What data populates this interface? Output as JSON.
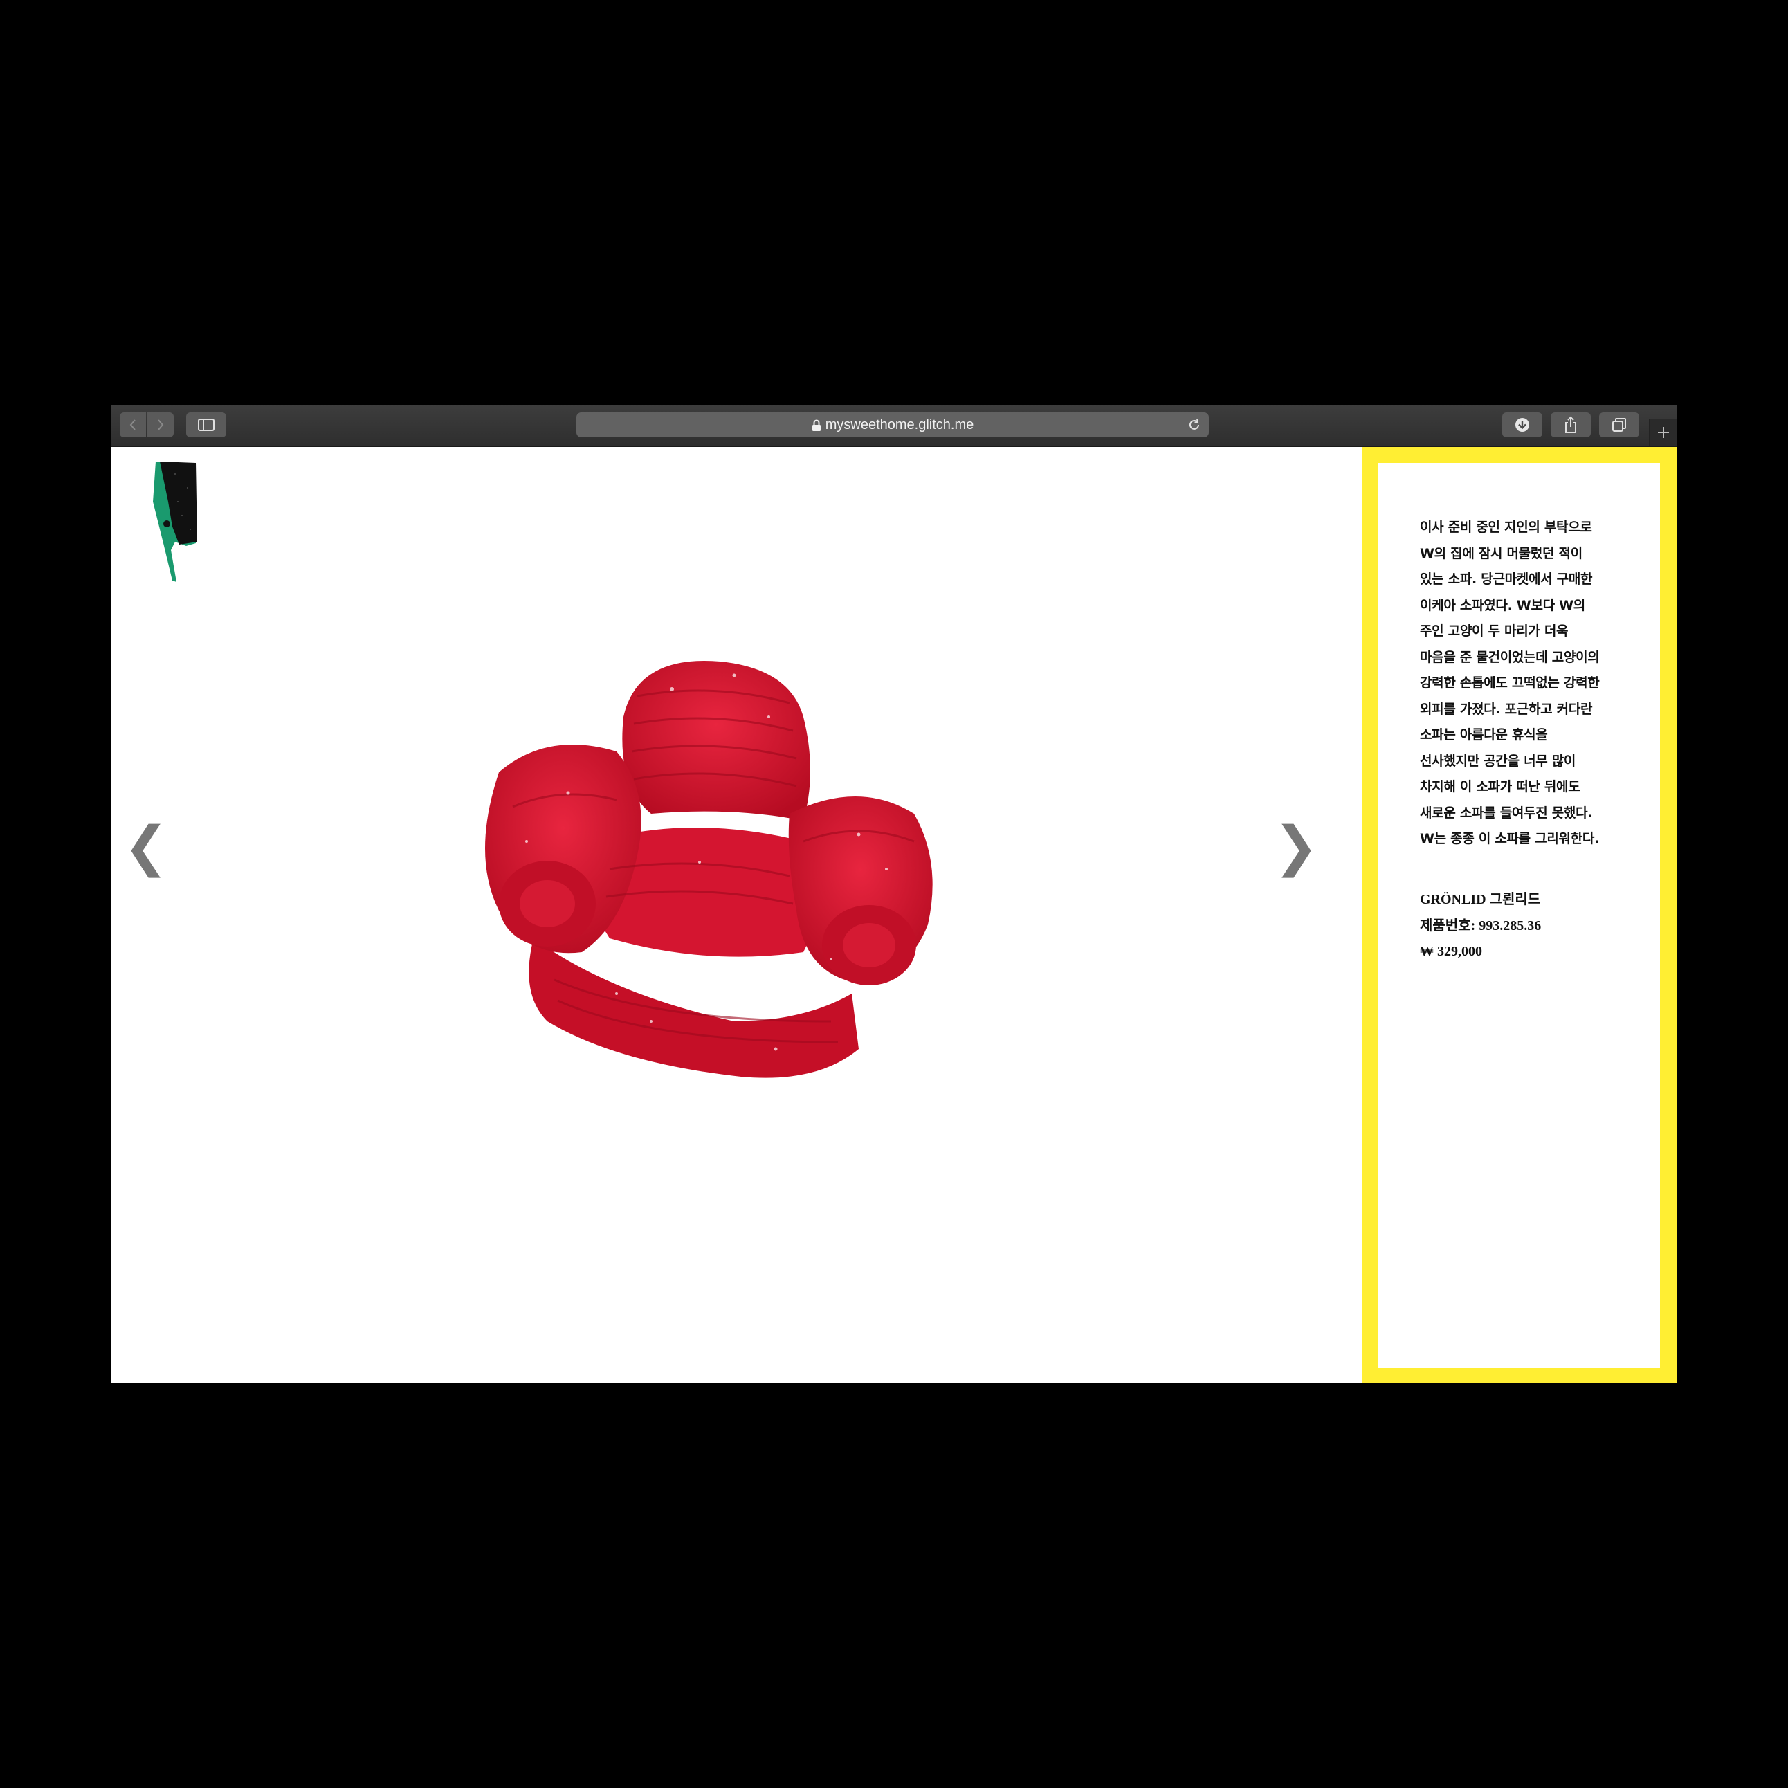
{
  "browser": {
    "url": "mysweethome.glitch.me",
    "back_icon": "chevron-left-icon",
    "forward_icon": "chevron-right-icon",
    "sidebar_icon": "sidebar-icon",
    "lock_icon": "lock-icon",
    "reload_icon": "reload-icon",
    "download_icon": "download-icon",
    "share_icon": "share-icon",
    "tabs_icon": "tabs-icon",
    "new_tab_icon": "plus-icon"
  },
  "page": {
    "prev_arrow": "❮",
    "next_arrow": "❯",
    "description_lines": [
      "이사 준비 중인 지인의 부탁으로",
      "W의 집에 잠시 머물렀던 적이",
      "있는 소파. 당근마켓에서 구매한",
      "이케아 소파였다. W보다 W의",
      "주인 고양이 두 마리가 더욱",
      "마음을 준 물건이었는데 고양이의",
      "강력한 손톱에도 끄떡없는 강력한",
      "외피를 가졌다. 포근하고 커다란",
      "소파는 아름다운 휴식을",
      "선사했지만 공간을 너무 많이",
      "차지해 이 소파가 떠난 뒤에도",
      "새로운 소파를 들여두진 못했다.",
      "W는 종종 이 소파를 그리워한다."
    ],
    "product_name": "GRÖNLID 그뢴리드",
    "product_number": "제품번호: 993.285.36",
    "price": "₩ 329,000"
  },
  "colors": {
    "panel_border": "#ffee33",
    "sofa": "#d8102c",
    "logo_green": "#1a9a6e",
    "logo_black": "#111111"
  }
}
